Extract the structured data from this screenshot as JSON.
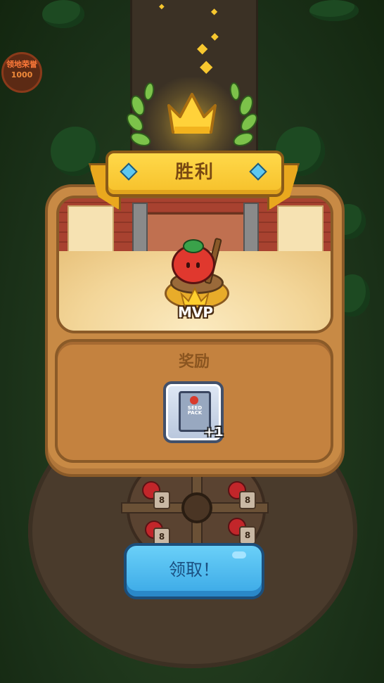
{
  "background": {
    "corner_badge_text": "领地荣誉",
    "corner_badge_sub": "1000"
  },
  "dialog": {
    "title": "胜利",
    "mvp_label": "MVP",
    "rewards_title": "奖励",
    "reward_item": {
      "icon": "seed-pack-icon",
      "label": "SEED PACK",
      "count": "+1"
    },
    "claim_button": "领取！"
  },
  "wheel": {
    "lock_number": "8"
  },
  "colors": {
    "panel": "#c88a45",
    "ribbon": "#f6c02a",
    "button": "#3aa8e6"
  }
}
